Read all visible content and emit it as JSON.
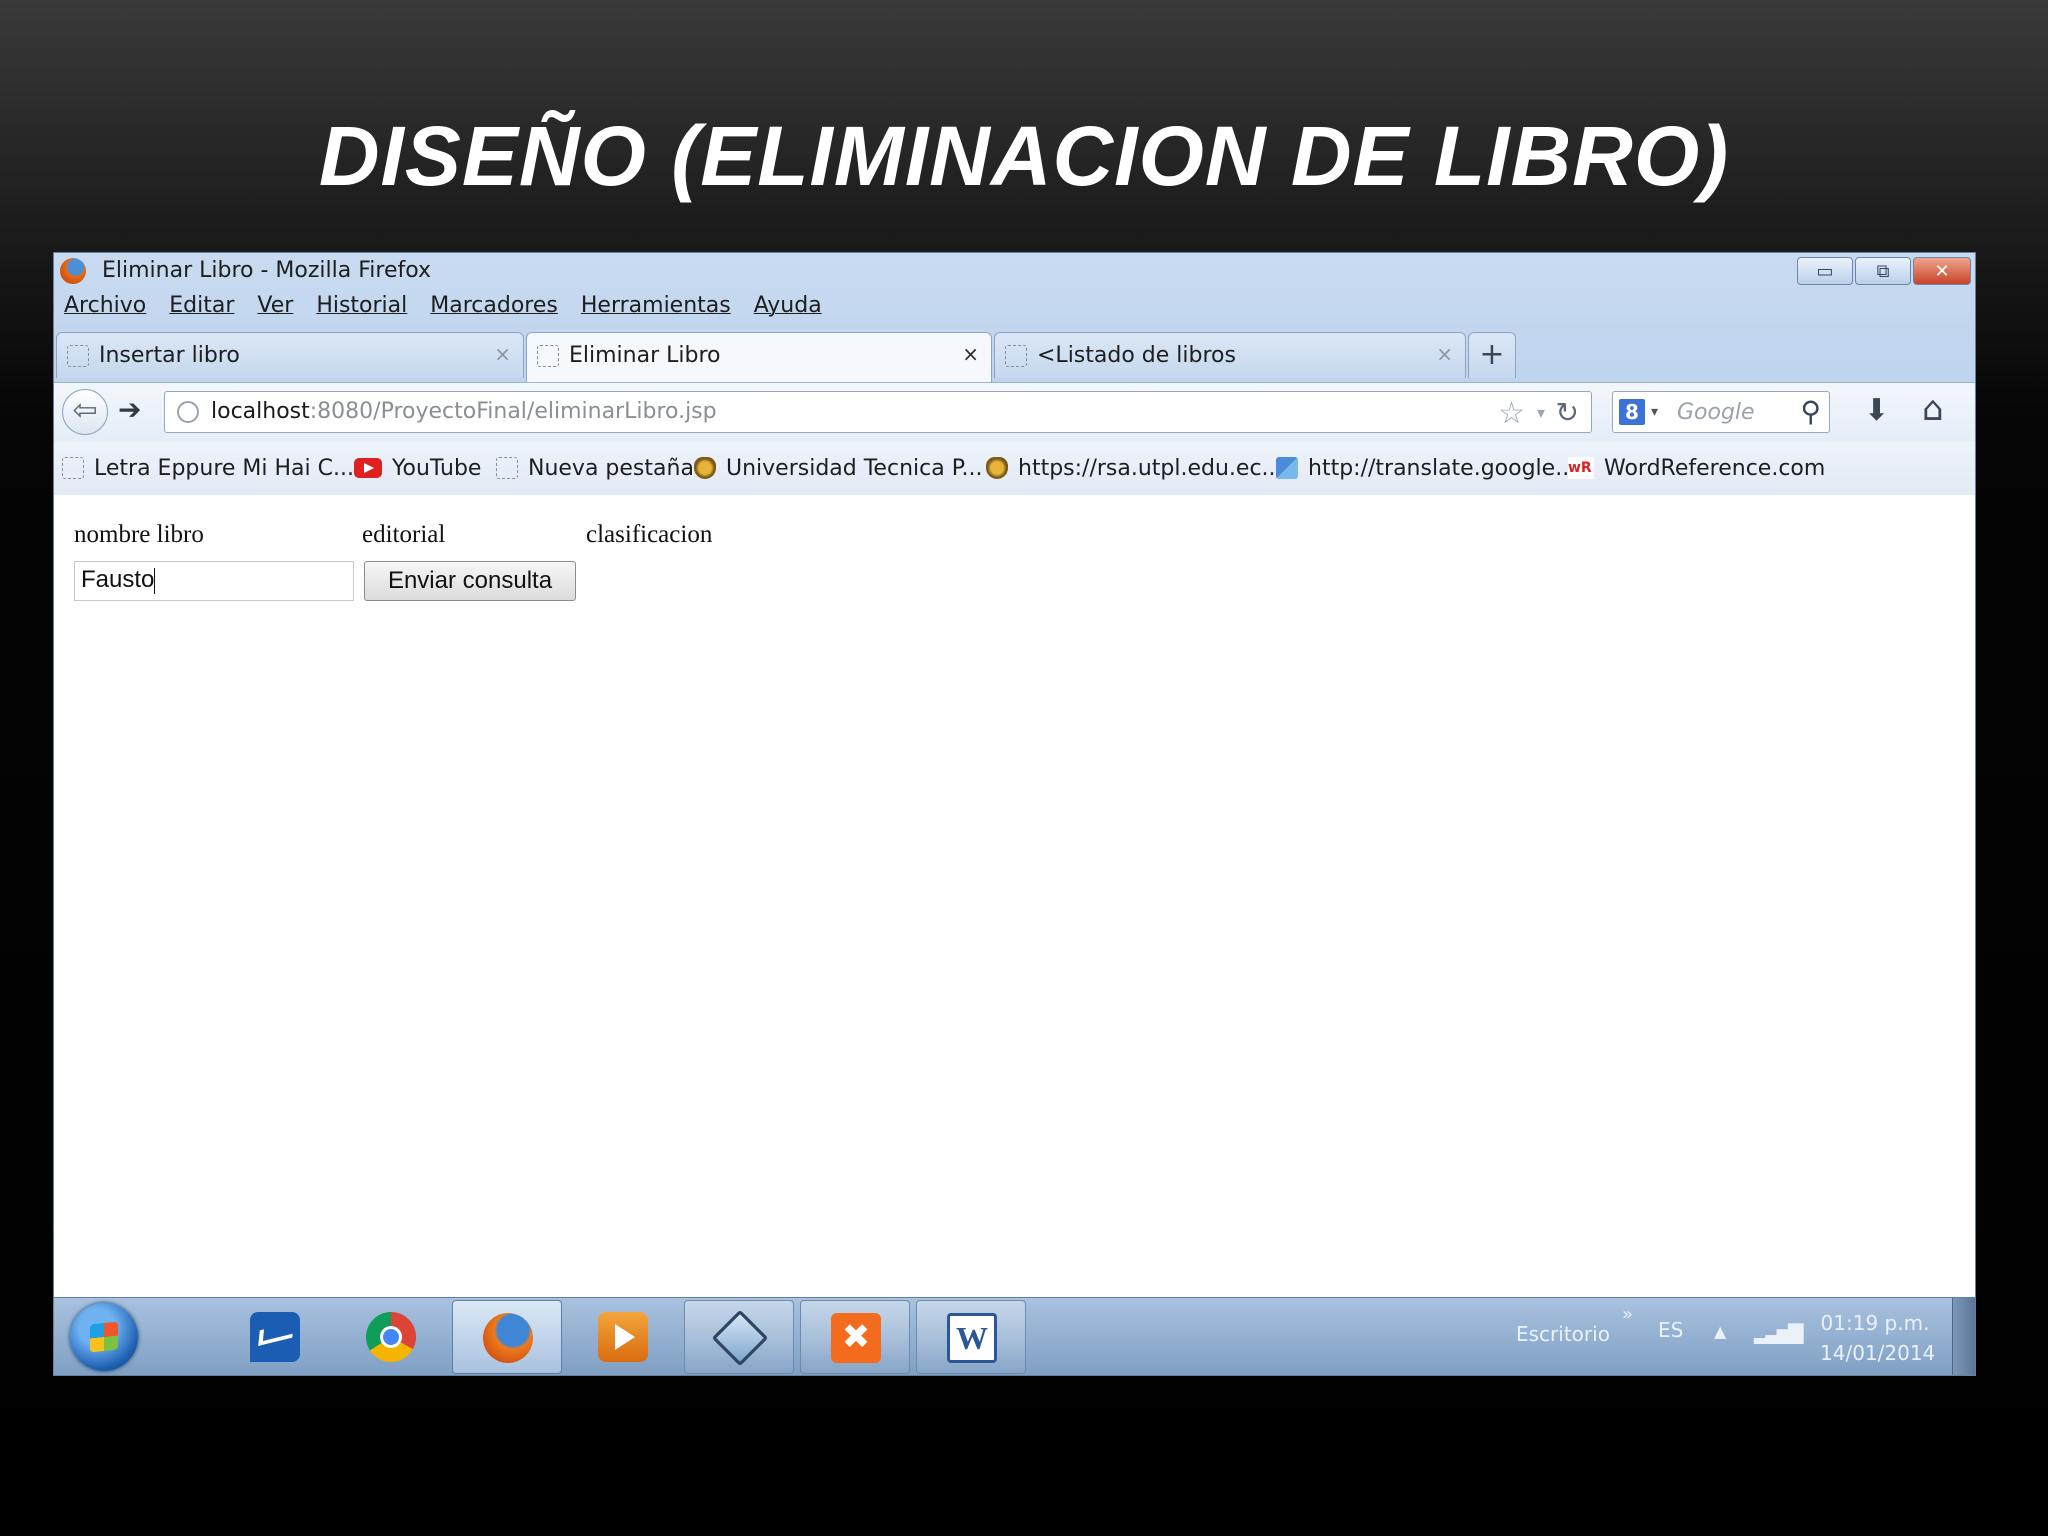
{
  "slide": {
    "title": "DISEÑO (ELIMINACION DE LIBRO)"
  },
  "window": {
    "title": "Eliminar Libro - Mozilla Firefox",
    "controls": {
      "minimize": "▭",
      "restore": "⧉",
      "close": "✕"
    }
  },
  "menubar": {
    "items": [
      {
        "label": "Archivo"
      },
      {
        "label": "Editar"
      },
      {
        "label": "Ver"
      },
      {
        "label": "Historial"
      },
      {
        "label": "Marcadores"
      },
      {
        "label": "Herramientas"
      },
      {
        "label": "Ayuda"
      }
    ]
  },
  "tabs": [
    {
      "label": "Insertar libro",
      "close": "×"
    },
    {
      "label": "Eliminar Libro",
      "close": "×"
    },
    {
      "label": "<Listado de libros",
      "close": "×"
    }
  ],
  "newtab": {
    "label": "+"
  },
  "navbar": {
    "back": "⇦",
    "forward": "➔",
    "url_host": "localhost",
    "url_rest": ":8080/ProyectoFinal/eliminarLibro.jsp",
    "star": "☆",
    "dropmarker": "▾",
    "reload": "↻",
    "search_engine": "8",
    "search_dropmarker": "▾",
    "search_placeholder": "Google",
    "search_button": "⚲",
    "downloads": "⬇",
    "home": "⌂"
  },
  "bookmarks": [
    {
      "label": "Letra Eppure Mi Hai C...",
      "icon": "page-icon"
    },
    {
      "label": "YouTube",
      "icon": "youtube-icon"
    },
    {
      "label": "Nueva pestaña",
      "icon": "page-icon"
    },
    {
      "label": "Universidad Tecnica P...",
      "icon": "utpl-icon"
    },
    {
      "label": "https://rsa.utpl.edu.ec...",
      "icon": "utpl-icon"
    },
    {
      "label": "http://translate.google...",
      "icon": "translate-icon"
    },
    {
      "label": "WordReference.com",
      "icon": "wordreference-icon",
      "icon_text": "wR"
    }
  ],
  "form": {
    "labels": {
      "nombre": "nombre libro",
      "editorial": "editorial",
      "clasificacion": "clasificacion"
    },
    "nombre_value": "Fausto",
    "submit": "Enviar consulta"
  },
  "taskbar": {
    "tray": {
      "desktop_label": "Escritorio",
      "chevron": "»",
      "language": "ES",
      "up": "▲",
      "signal": "▂▃▅▇",
      "time": "01:19 p.m.",
      "date": "14/01/2014"
    }
  }
}
